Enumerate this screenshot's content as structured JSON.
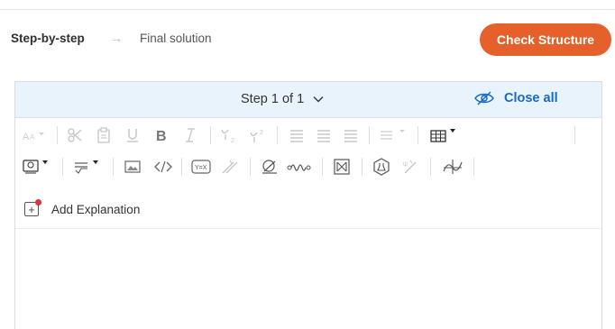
{
  "header": {
    "breadcrumb_active": "Step-by-step",
    "breadcrumb_arrow": "→",
    "breadcrumb_next": "Final solution",
    "check_button": "Check Structure"
  },
  "step_bar": {
    "step_label": "Step 1 of 1",
    "close_all": "Close all"
  },
  "toolbar": {
    "row1": [
      "font-size-icon",
      "format-painter-icon",
      "paste-icon",
      "underline-icon",
      "bold-icon",
      "italic-icon",
      "subscript-icon",
      "superscript-icon",
      "align-left-icon",
      "align-center-icon",
      "align-right-icon",
      "list-icon",
      "table-icon"
    ],
    "row2": [
      "money-icon",
      "math-icon",
      "image-icon",
      "code-icon",
      "equation-icon",
      "chemistry-icon",
      "graph-icon",
      "waveform-icon",
      "matrix-icon",
      "lab-icon",
      "physics-icon",
      "function-icon"
    ]
  },
  "add_explanation": "Add Explanation",
  "colors": {
    "accent": "#e5602a",
    "link": "#1769c5",
    "step_bar_bg": "#e9f3fb",
    "notification_dot": "#e03333"
  }
}
